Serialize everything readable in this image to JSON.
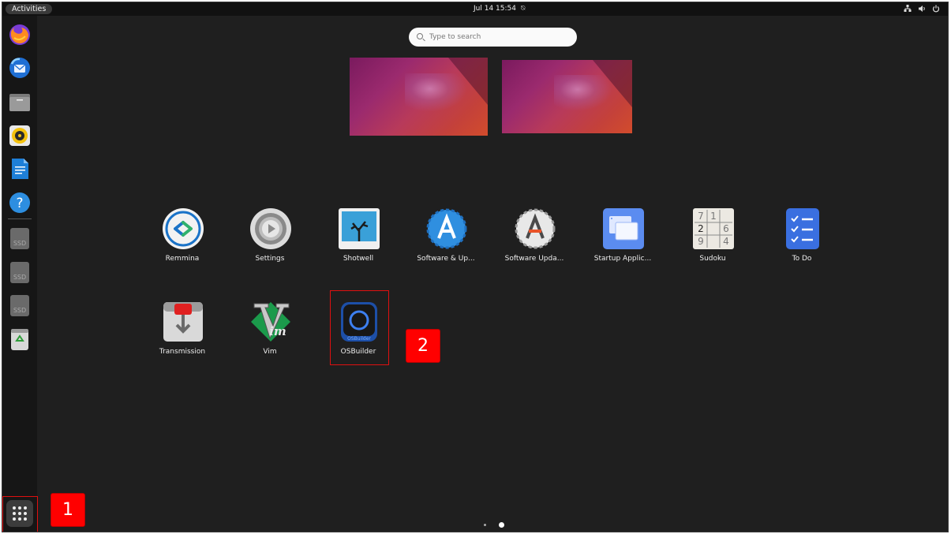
{
  "topbar": {
    "activities": "Activities",
    "clock": "Jul 14  15:54"
  },
  "dock": {
    "items": [
      {
        "name": "firefox-icon"
      },
      {
        "name": "thunderbird-icon"
      },
      {
        "name": "files-icon"
      },
      {
        "name": "rhythmbox-icon"
      },
      {
        "name": "writer-icon"
      },
      {
        "name": "help-icon"
      },
      {
        "name": "ssd-drive-icon",
        "label": "SSD"
      },
      {
        "name": "ssd-drive-icon",
        "label": "SSD"
      },
      {
        "name": "ssd-drive-icon",
        "label": "SSD"
      },
      {
        "name": "trash-icon"
      }
    ]
  },
  "search": {
    "placeholder": "Type to search"
  },
  "apps": {
    "row1": [
      "Remmina",
      "Settings",
      "Shotwell",
      "Software & Up...",
      "Software Upda...",
      "Startup Applic...",
      "Sudoku",
      "To Do"
    ],
    "row2": [
      "Transmission",
      "Vim",
      "OSBuilder"
    ]
  },
  "sudoku_digits": [
    "7",
    "1",
    "2",
    "6",
    "9",
    "4"
  ],
  "osbuilder_icon_text": "OSBuilder",
  "vim_icon_text": "im",
  "ssd_label": "SSD",
  "annotations": {
    "badge1": "1",
    "badge2": "2"
  },
  "colors": {
    "highlight": "#e01010",
    "badge": "#ff0000",
    "background": "#1f1f1f"
  }
}
